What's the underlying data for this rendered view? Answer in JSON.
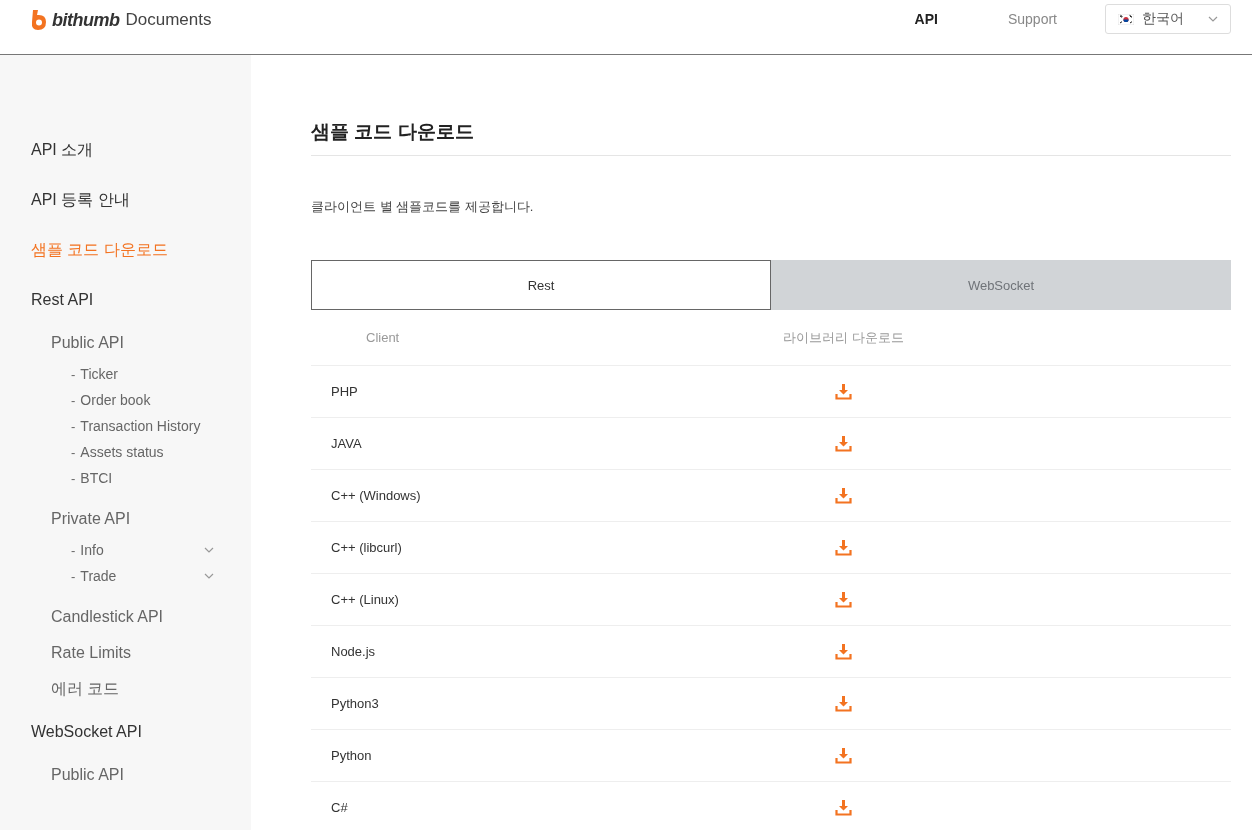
{
  "header": {
    "brand": "bithumb",
    "product": "Documents",
    "nav": [
      {
        "label": "API",
        "selected": true
      },
      {
        "label": "Support",
        "selected": false
      }
    ],
    "language": "한국어"
  },
  "sidebar": {
    "items": [
      {
        "label": "API 소개",
        "selected": false
      },
      {
        "label": "API 등록 안내",
        "selected": false
      },
      {
        "label": "샘플 코드 다운로드",
        "selected": true
      },
      {
        "label": "Rest API",
        "selected": false,
        "children": [
          {
            "label": "Public API",
            "selected": false,
            "children": [
              {
                "label": "Ticker",
                "marker": "-",
                "selected": false
              },
              {
                "label": "Order book",
                "marker": "-",
                "selected": false
              },
              {
                "label": "Transaction History",
                "marker": "-",
                "selected": false
              },
              {
                "label": "Assets status",
                "marker": "-",
                "selected": false
              },
              {
                "label": "BTCI",
                "marker": "-",
                "selected": false
              }
            ]
          },
          {
            "label": "Private API",
            "selected": false,
            "children": [
              {
                "label": "Info",
                "marker": "-",
                "selected": false,
                "expanded": false
              },
              {
                "label": "Trade",
                "marker": "-",
                "selected": false,
                "expanded": false
              }
            ]
          },
          {
            "label": "Candlestick API",
            "selected": false
          },
          {
            "label": "Rate Limits",
            "selected": false
          },
          {
            "label": "에러 코드",
            "selected": false
          }
        ]
      },
      {
        "label": "WebSocket API",
        "selected": false,
        "children": [
          {
            "label": "Public API",
            "selected": false
          }
        ]
      }
    ]
  },
  "main": {
    "title": "샘플 코드 다운로드",
    "description": "클라이언트 별 샘플코드를 제공합니다.",
    "tabs": [
      {
        "label": "Rest",
        "selected": true
      },
      {
        "label": "WebSocket",
        "selected": false
      }
    ],
    "table": {
      "columns": [
        "Client",
        "라이브러리 다운로드"
      ],
      "rows": [
        {
          "client": "PHP"
        },
        {
          "client": "JAVA"
        },
        {
          "client": "C++ (Windows)"
        },
        {
          "client": "C++ (libcurl)"
        },
        {
          "client": "C++ (Linux)"
        },
        {
          "client": "Node.js"
        },
        {
          "client": "Python3"
        },
        {
          "client": "Python"
        },
        {
          "client": "C#"
        }
      ]
    }
  }
}
